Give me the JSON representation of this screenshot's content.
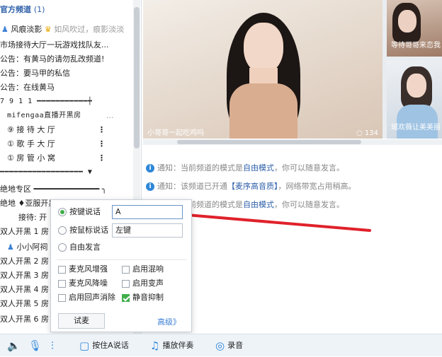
{
  "channel": {
    "title": "官方频道",
    "count": "(1)",
    "user": "风痕淡影",
    "user_status": "如风吹过，痕影淡淡",
    "rows": [
      "市场接待大厅一玩游戏找队友...",
      "公告：有黄马的请勿乱改频道!",
      "公告：要马甲的私信",
      "公告：在线黄马",
      "7 9 1 1 ━━━━━━━━━━━┿",
      "mifengaa直播开黑房",
      "⑨ 接 待 大 厅",
      "① 歌 手 大 厅",
      "① 房 管 小 窝",
      "━━━━━━━━━━━━━━━━━━ ▼",
      "绝地专区 ━━━━━━━━━━━━━━ ╮",
      "绝地 ♦亚服开黑",
      "接待: 开",
      "双人开黑 1 房",
      "小小阿祠",
      "双人开黑 2 房",
      "双人开黑 3 房",
      "双人开黑 4 房",
      "双人开黑 5 房",
      "双人开黑 6 房"
    ],
    "dots_label": "..."
  },
  "video": {
    "caption": "小哥哥一起吃鸡吗",
    "viewers": "○ 134",
    "thumb1_caption": "等待哥哥来恋我",
    "thumb2_caption": "城欢薇让美美丽"
  },
  "notices": [
    {
      "prefix": "通知：当前频道的模式是",
      "highlight": "自由模式",
      "suffix": "，你可以随意发言。"
    },
    {
      "prefix": "通知：该频道已开通",
      "highlight": "【麦序高音质】",
      "suffix": "，网络带宽占用稍高。"
    },
    {
      "prefix": "通知：当前频道的模式是",
      "highlight": "自由模式",
      "suffix": "，你可以随意发言。"
    }
  ],
  "popup": {
    "radio_key": "按键说话",
    "key_value": "A",
    "radio_mouse": "按鼠标说话",
    "mouse_value": "左键",
    "radio_free": "自由发言",
    "cb_mic_boost": "麦克风增强",
    "cb_mix": "启用混响",
    "cb_noise": "麦克风降噪",
    "cb_voice_change": "启用变声",
    "cb_echo": "启用回声消除",
    "cb_mute": "静音抑制",
    "btn_test": "试麦",
    "advanced": "高级》"
  },
  "toolbar": {
    "press_a": "按住A说话",
    "play_music": "播放伴奏",
    "record": "录音"
  },
  "colors": {
    "accent_blue": "#2e87d8",
    "green_check": "#3fae49",
    "arrow_red": "#e0212a"
  }
}
